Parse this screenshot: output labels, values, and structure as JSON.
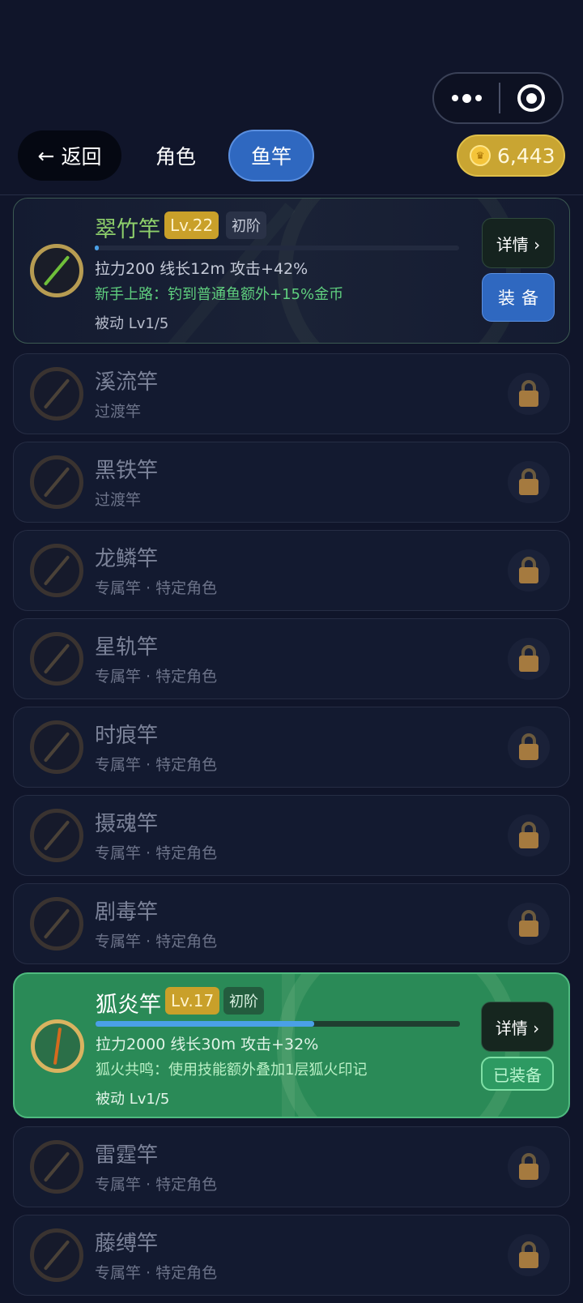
{
  "capsule": {
    "menu_icon": "more-dots-icon",
    "close_icon": "target-ring-icon"
  },
  "nav": {
    "back_label": "返回",
    "tabs": [
      {
        "label": "角色",
        "active": false
      },
      {
        "label": "鱼竿",
        "active": true
      }
    ],
    "coins": "6,443"
  },
  "current_rod": {
    "name": "翠竹竿",
    "level": "Lv.22",
    "tier": "初阶",
    "xp_fraction": 0.01,
    "stats": "拉力200  线长12m  攻击+42%",
    "skill": "新手上路：钓到普通鱼额外+15%金币",
    "passive": "被动 Lv1/5",
    "detail_label": "详情 ›",
    "equip_label": "装备"
  },
  "locked_rods": [
    {
      "name": "溪流竿",
      "sub": "过渡竿"
    },
    {
      "name": "黑铁竿",
      "sub": "过渡竿"
    },
    {
      "name": "龙鳞竿",
      "sub": "专属竿 · 特定角色"
    },
    {
      "name": "星轨竿",
      "sub": "专属竿 · 特定角色"
    },
    {
      "name": "时痕竿",
      "sub": "专属竿 · 特定角色"
    },
    {
      "name": "摄魂竿",
      "sub": "专属竿 · 特定角色"
    },
    {
      "name": "剧毒竿",
      "sub": "专属竿 · 特定角色"
    }
  ],
  "equipped_rod": {
    "name": "狐炎竿",
    "level": "Lv.17",
    "tier": "初阶",
    "xp_fraction": 0.6,
    "stats": "拉力2000  线长30m  攻击+32%",
    "skill": "狐火共鸣：使用技能额外叠加1层狐火印记",
    "passive": "被动 Lv1/5",
    "detail_label": "详情 ›",
    "equipped_label": "已装备"
  },
  "locked_rods_after": [
    {
      "name": "雷霆竿",
      "sub": "专属竿 · 特定角色"
    },
    {
      "name": "藤缚竿",
      "sub": "专属竿 · 特定角色"
    }
  ],
  "colors": {
    "accent_blue": "#2f68c0",
    "equipped_green": "#2a8a57",
    "coin_gold": "#c9a532"
  }
}
